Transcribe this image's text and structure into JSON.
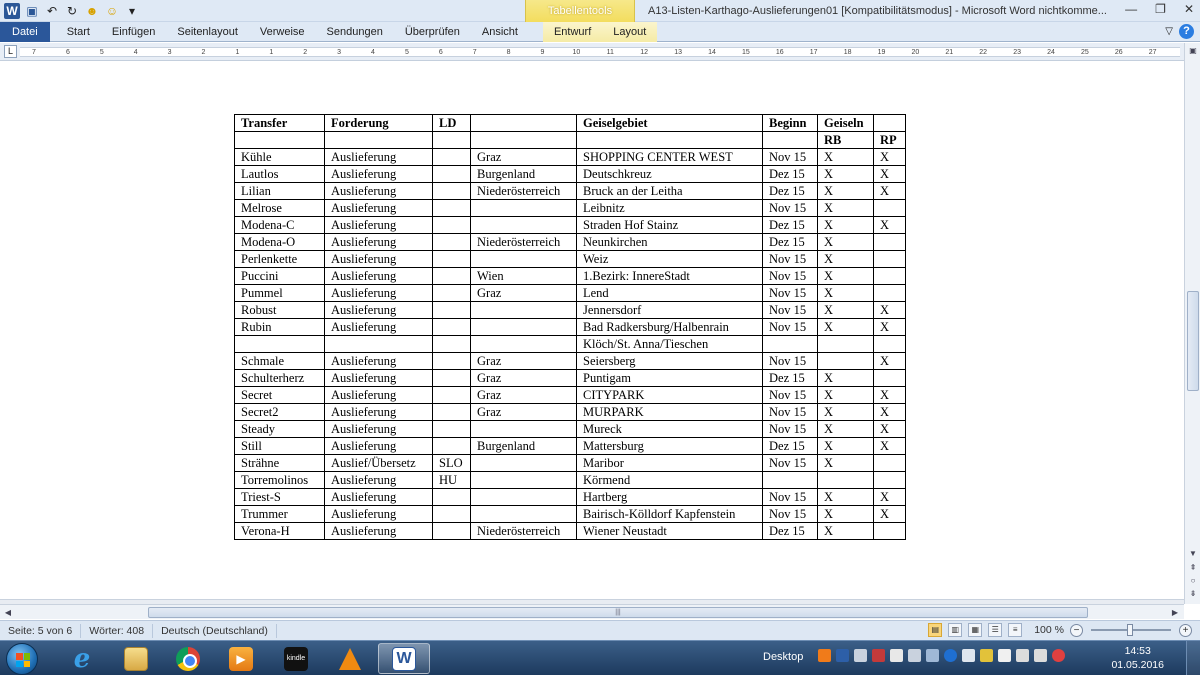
{
  "titlebar": {
    "context_tab_group": "Tabellentools",
    "document_title": "A13-Listen-Karthago-Auslieferungen01 [Kompatibilitätsmodus] - Microsoft Word nichtkomme..."
  },
  "ribbon": {
    "tabs": [
      "Datei",
      "Start",
      "Einfügen",
      "Seitenlayout",
      "Verweise",
      "Sendungen",
      "Überprüfen",
      "Ansicht",
      "Entwurf",
      "Layout"
    ]
  },
  "ruler": {
    "labels": [
      "7",
      "6",
      "5",
      "4",
      "3",
      "2",
      "1",
      "1",
      "2",
      "3",
      "4",
      "5",
      "6",
      "7",
      "8",
      "9",
      "10",
      "11",
      "12",
      "13",
      "14",
      "15",
      "16",
      "17",
      "18",
      "19",
      "20",
      "21",
      "22",
      "23",
      "24",
      "25",
      "26",
      "27"
    ]
  },
  "table": {
    "header1": [
      "Transfer",
      "Forderung",
      "LD",
      "",
      "Geiselgebiet",
      "Beginn",
      "Geiseln",
      ""
    ],
    "header2": [
      "",
      "",
      "",
      "",
      "",
      "",
      "RB",
      "RP"
    ],
    "rows": [
      [
        "Kühle",
        "Auslieferung",
        "",
        "Graz",
        "SHOPPING CENTER WEST",
        "Nov 15",
        "X",
        "X"
      ],
      [
        "Lautlos",
        "Auslieferung",
        "",
        "Burgenland",
        "Deutschkreuz",
        "Dez 15",
        "X",
        "X"
      ],
      [
        "Lilian",
        "Auslieferung",
        "",
        "Niederösterreich",
        "Bruck an der Leitha",
        "Dez 15",
        "X",
        "X"
      ],
      [
        "Melrose",
        "Auslieferung",
        "",
        "",
        "Leibnitz",
        "Nov 15",
        "X",
        ""
      ],
      [
        "Modena-C",
        "Auslieferung",
        "",
        "",
        "Straden Hof Stainz",
        "Dez 15",
        "X",
        "X"
      ],
      [
        "Modena-O",
        "Auslieferung",
        "",
        "Niederösterreich",
        "Neunkirchen",
        "Dez 15",
        "X",
        ""
      ],
      [
        "Perlenkette",
        "Auslieferung",
        "",
        "",
        "Weiz",
        "Nov 15",
        "X",
        ""
      ],
      [
        "Puccini",
        "Auslieferung",
        "",
        "Wien",
        "1.Bezirk: InnereStadt",
        "Nov 15",
        "X",
        ""
      ],
      [
        "Pummel",
        "Auslieferung",
        "",
        "Graz",
        "Lend",
        "Nov 15",
        "X",
        ""
      ],
      [
        "Robust",
        "Auslieferung",
        "",
        "",
        "Jennersdorf",
        "Nov 15",
        "X",
        "X"
      ],
      [
        "Rubin",
        "Auslieferung",
        "",
        "",
        "Bad Radkersburg/Halbenrain",
        "Nov 15",
        "X",
        "X"
      ],
      [
        "",
        "",
        "",
        "",
        "Klöch/St. Anna/Tieschen",
        "",
        "",
        ""
      ],
      [
        "Schmale",
        "Auslieferung",
        "",
        "Graz",
        "Seiersberg",
        "Nov 15",
        "",
        "X"
      ],
      [
        "Schulterherz",
        "Auslieferung",
        "",
        "Graz",
        "Puntigam",
        "Dez 15",
        "X",
        ""
      ],
      [
        "Secret",
        "Auslieferung",
        "",
        "Graz",
        "CITYPARK",
        "Nov 15",
        "X",
        "X"
      ],
      [
        "Secret2",
        "Auslieferung",
        "",
        "Graz",
        "MURPARK",
        "Nov 15",
        "X",
        "X"
      ],
      [
        "Steady",
        "Auslieferung",
        "",
        "",
        "Mureck",
        "Nov 15",
        "X",
        "X"
      ],
      [
        "Still",
        "Auslieferung",
        "",
        "Burgenland",
        "Mattersburg",
        "Dez 15",
        "X",
        "X"
      ],
      [
        "Strähne",
        "Auslief/Übersetz",
        "SLO",
        "",
        "Maribor",
        "Nov 15",
        "X",
        ""
      ],
      [
        "Torremolinos",
        "Auslieferung",
        "HU",
        "",
        "Körmend",
        "",
        "",
        ""
      ],
      [
        "Triest-S",
        "Auslieferung",
        "",
        "",
        "Hartberg",
        "Nov 15",
        "X",
        "X"
      ],
      [
        "Trummer",
        "Auslieferung",
        "",
        "",
        "Bairisch-Kölldorf Kapfenstein",
        "Nov 15",
        "X",
        "X"
      ],
      [
        "Verona-H",
        "Auslieferung",
        "",
        "Niederösterreich",
        "Wiener Neustadt",
        "Dez 15",
        "X",
        ""
      ]
    ]
  },
  "statusbar": {
    "page": "Seite: 5 von 6",
    "words": "Wörter: 408",
    "language": "Deutsch (Deutschland)",
    "zoom": "100 %"
  },
  "taskbar": {
    "desktop_label": "Desktop",
    "time": "14:53",
    "date": "01.05.2016",
    "kindle_label": "kindle"
  }
}
